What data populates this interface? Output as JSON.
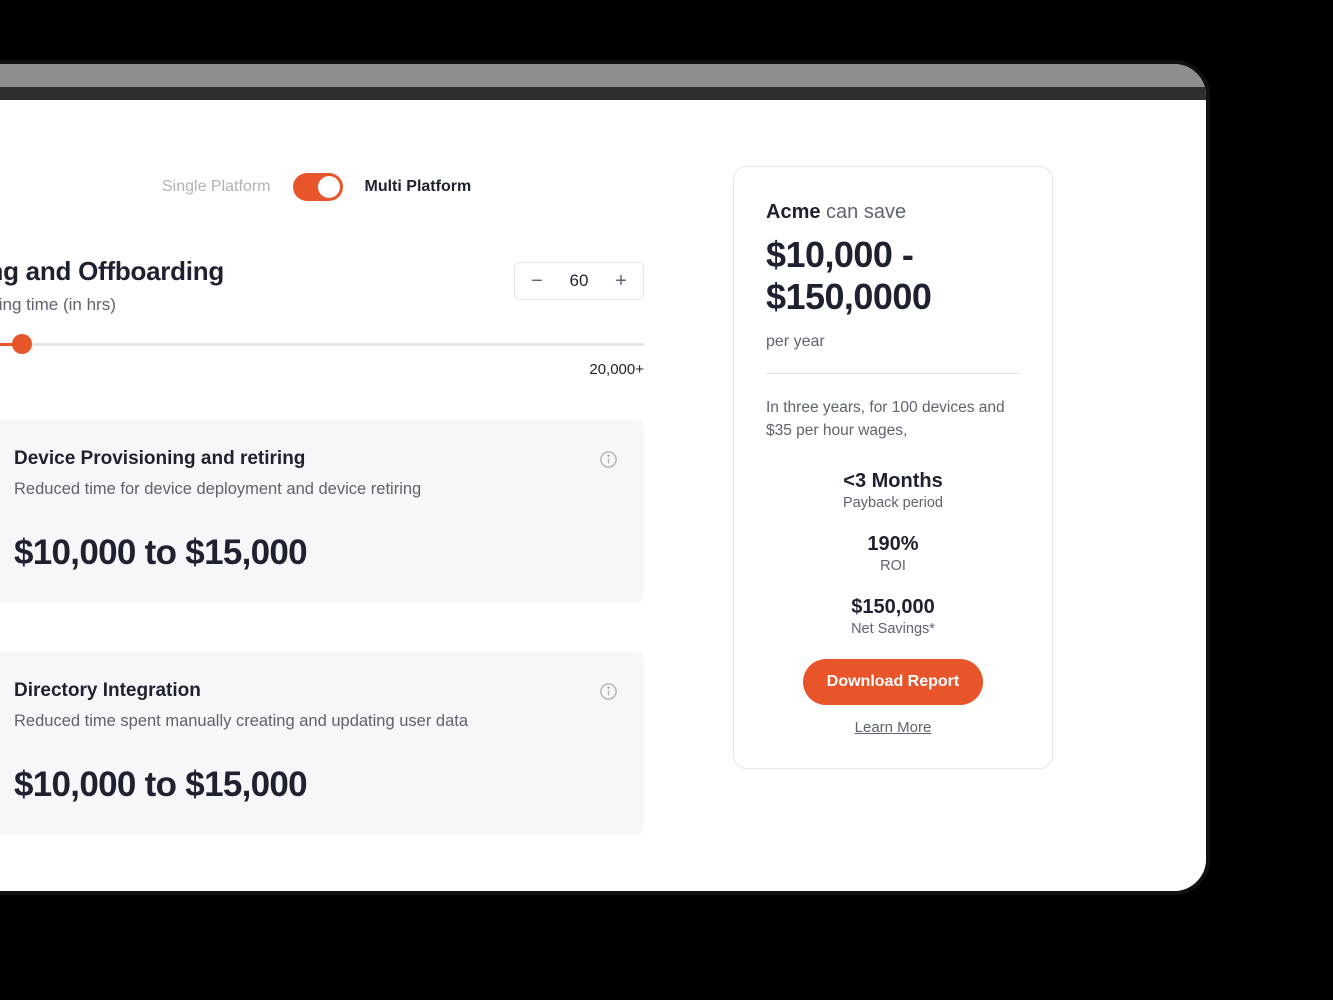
{
  "toggle": {
    "single_label": "Single Platform",
    "multi_label": "Multi Platform",
    "state": "multi"
  },
  "onboarding": {
    "title": "Onboarding and Offboarding",
    "subtitle": "Device provisioning time (in hrs)",
    "stepper_value": "60",
    "slider_max_label": "20,000+"
  },
  "cards": [
    {
      "title": "Device Provisioning and retiring",
      "desc": "Reduced time for device deployment and device retiring",
      "value": "$10,000 to $15,000"
    },
    {
      "title": "Directory Integration",
      "desc": "Reduced time spent manually creating and updating user data",
      "value": "$10,000 to $15,000"
    }
  ],
  "summary": {
    "company": "Acme",
    "can_save": "can save",
    "range": "$10,000 - $150,0000",
    "per": "per year",
    "details": "In three years, for 100 devices and $35 per hour wages,",
    "metrics": [
      {
        "value": "<3 Months",
        "label": "Payback period"
      },
      {
        "value": "190%",
        "label": "ROI"
      },
      {
        "value": "$150,000",
        "label": "Net Savings*"
      }
    ],
    "download_btn": "Download Report",
    "learn_more": "Learn More"
  }
}
